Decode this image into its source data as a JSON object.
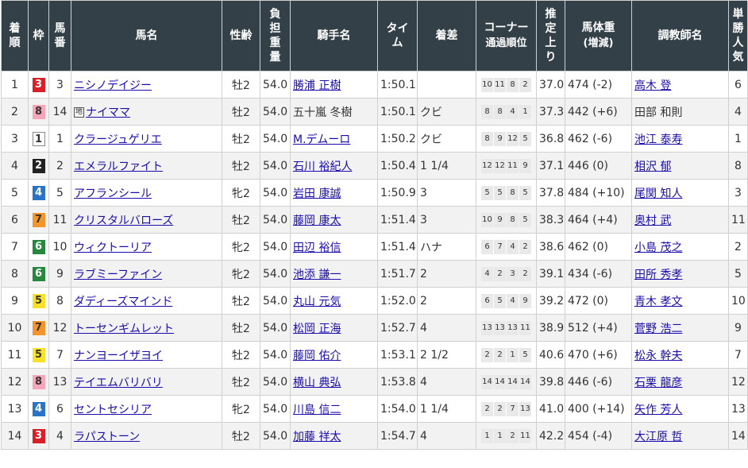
{
  "headers": {
    "chakujun": "着順",
    "waku": "枠",
    "umaban": "馬番",
    "bamei": "馬名",
    "seirei": "性齢",
    "futan": "負担重量",
    "kishu": "騎手名",
    "time": "タイム",
    "chakusa": "着差",
    "corner_line1": "コーナー",
    "corner_line2": "通過順位",
    "agari": "推定上り",
    "bataiju_line1": "馬体重",
    "bataiju_line2": "(増減)",
    "chokyoshi": "調教師名",
    "ninki": "単勝人気"
  },
  "rows": [
    {
      "rank": "1",
      "waku": "3",
      "umaban": "3",
      "horse": "ニシノデイジー",
      "mark": "",
      "sexage": "牡2",
      "weight": "54.0",
      "jockey": "勝浦 正樹",
      "jockey_link": true,
      "time": "1:50.1",
      "margin": "",
      "corner": [
        "10",
        "11",
        "8",
        "2"
      ],
      "agari": "37.0",
      "bw": "474 (-2)",
      "trainer": "高木 登",
      "trainer_link": true,
      "pop": "6"
    },
    {
      "rank": "2",
      "waku": "8",
      "umaban": "14",
      "horse": "ナイママ",
      "mark": "地",
      "sexage": "牡2",
      "weight": "54.0",
      "jockey": "五十嵐 冬樹",
      "jockey_link": false,
      "time": "1:50.1",
      "margin": "クビ",
      "corner": [
        "8",
        "8",
        "4",
        "1"
      ],
      "agari": "37.3",
      "bw": "442 (+6)",
      "trainer": "田部 和則",
      "trainer_link": false,
      "pop": "4"
    },
    {
      "rank": "3",
      "waku": "1",
      "umaban": "1",
      "horse": "クラージュゲリエ",
      "mark": "",
      "sexage": "牡2",
      "weight": "54.0",
      "jockey": "M.デムーロ",
      "jockey_link": true,
      "time": "1:50.2",
      "margin": "クビ",
      "corner": [
        "8",
        "9",
        "12",
        "5"
      ],
      "agari": "36.8",
      "bw": "462 (-6)",
      "trainer": "池江 泰寿",
      "trainer_link": true,
      "pop": "1"
    },
    {
      "rank": "4",
      "waku": "2",
      "umaban": "2",
      "horse": "エメラルファイト",
      "mark": "",
      "sexage": "牡2",
      "weight": "54.0",
      "jockey": "石川 裕紀人",
      "jockey_link": true,
      "time": "1:50.4",
      "margin": "1 1/4",
      "corner": [
        "12",
        "12",
        "11",
        "9"
      ],
      "agari": "37.1",
      "bw": "446 (0)",
      "trainer": "相沢 郁",
      "trainer_link": true,
      "pop": "8"
    },
    {
      "rank": "5",
      "waku": "4",
      "umaban": "5",
      "horse": "アフランシール",
      "mark": "",
      "sexage": "牝2",
      "weight": "54.0",
      "jockey": "岩田 康誠",
      "jockey_link": true,
      "time": "1:50.9",
      "margin": "3",
      "corner": [
        "5",
        "5",
        "8",
        "5"
      ],
      "agari": "37.8",
      "bw": "484 (+10)",
      "trainer": "尾関 知人",
      "trainer_link": true,
      "pop": "3"
    },
    {
      "rank": "6",
      "waku": "7",
      "umaban": "11",
      "horse": "クリスタルバローズ",
      "mark": "",
      "sexage": "牡2",
      "weight": "54.0",
      "jockey": "藤岡 康太",
      "jockey_link": true,
      "time": "1:51.4",
      "margin": "3",
      "corner": [
        "10",
        "9",
        "8",
        "5"
      ],
      "agari": "38.3",
      "bw": "464 (+4)",
      "trainer": "奥村 武",
      "trainer_link": true,
      "pop": "11"
    },
    {
      "rank": "7",
      "waku": "6",
      "umaban": "10",
      "horse": "ウィクトーリア",
      "mark": "",
      "sexage": "牝2",
      "weight": "54.0",
      "jockey": "田辺 裕信",
      "jockey_link": true,
      "time": "1:51.4",
      "margin": "ハナ",
      "corner": [
        "6",
        "7",
        "4",
        "2"
      ],
      "agari": "38.6",
      "bw": "462 (0)",
      "trainer": "小島 茂之",
      "trainer_link": true,
      "pop": "2"
    },
    {
      "rank": "8",
      "waku": "6",
      "umaban": "9",
      "horse": "ラブミーファイン",
      "mark": "",
      "sexage": "牝2",
      "weight": "54.0",
      "jockey": "池添 謙一",
      "jockey_link": true,
      "time": "1:51.7",
      "margin": "2",
      "corner": [
        "4",
        "2",
        "3",
        "2"
      ],
      "agari": "39.1",
      "bw": "434 (-6)",
      "trainer": "田所 秀孝",
      "trainer_link": true,
      "pop": "5"
    },
    {
      "rank": "9",
      "waku": "5",
      "umaban": "8",
      "horse": "ダディーズマインド",
      "mark": "",
      "sexage": "牡2",
      "weight": "54.0",
      "jockey": "丸山 元気",
      "jockey_link": true,
      "time": "1:52.0",
      "margin": "2",
      "corner": [
        "6",
        "5",
        "4",
        "9"
      ],
      "agari": "39.2",
      "bw": "472 (0)",
      "trainer": "青木 孝文",
      "trainer_link": true,
      "pop": "10"
    },
    {
      "rank": "10",
      "waku": "7",
      "umaban": "12",
      "horse": "トーセンギムレット",
      "mark": "",
      "sexage": "牡2",
      "weight": "54.0",
      "jockey": "松岡 正海",
      "jockey_link": true,
      "time": "1:52.7",
      "margin": "4",
      "corner": [
        "13",
        "13",
        "13",
        "11"
      ],
      "agari": "38.9",
      "bw": "512 (+4)",
      "trainer": "菅野 浩二",
      "trainer_link": true,
      "pop": "9"
    },
    {
      "rank": "11",
      "waku": "5",
      "umaban": "7",
      "horse": "ナンヨーイザヨイ",
      "mark": "",
      "sexage": "牡2",
      "weight": "54.0",
      "jockey": "藤岡 佑介",
      "jockey_link": true,
      "time": "1:53.1",
      "margin": "2 1/2",
      "corner": [
        "2",
        "2",
        "1",
        "5"
      ],
      "agari": "40.6",
      "bw": "470 (+6)",
      "trainer": "松永 幹夫",
      "trainer_link": true,
      "pop": "7"
    },
    {
      "rank": "12",
      "waku": "8",
      "umaban": "13",
      "horse": "テイエムバリバリ",
      "mark": "",
      "sexage": "牡2",
      "weight": "54.0",
      "jockey": "横山 典弘",
      "jockey_link": true,
      "time": "1:53.8",
      "margin": "4",
      "corner": [
        "14",
        "14",
        "14",
        "14"
      ],
      "agari": "39.8",
      "bw": "446 (-6)",
      "trainer": "石栗 龍彦",
      "trainer_link": true,
      "pop": "12"
    },
    {
      "rank": "13",
      "waku": "4",
      "umaban": "6",
      "horse": "セントセシリア",
      "mark": "",
      "sexage": "牝2",
      "weight": "54.0",
      "jockey": "川島 信二",
      "jockey_link": true,
      "time": "1:54.0",
      "margin": "1 1/4",
      "corner": [
        "2",
        "2",
        "7",
        "13"
      ],
      "agari": "41.0",
      "bw": "400 (+14)",
      "trainer": "矢作 芳人",
      "trainer_link": true,
      "pop": "13"
    },
    {
      "rank": "14",
      "waku": "3",
      "umaban": "4",
      "horse": "ラパストーン",
      "mark": "",
      "sexage": "牡2",
      "weight": "54.0",
      "jockey": "加藤 祥太",
      "jockey_link": true,
      "time": "1:54.7",
      "margin": "4",
      "corner": [
        "1",
        "1",
        "2",
        "11"
      ],
      "agari": "42.2",
      "bw": "454 (-4)",
      "trainer": "大江原 哲",
      "trainer_link": true,
      "pop": "14"
    }
  ]
}
